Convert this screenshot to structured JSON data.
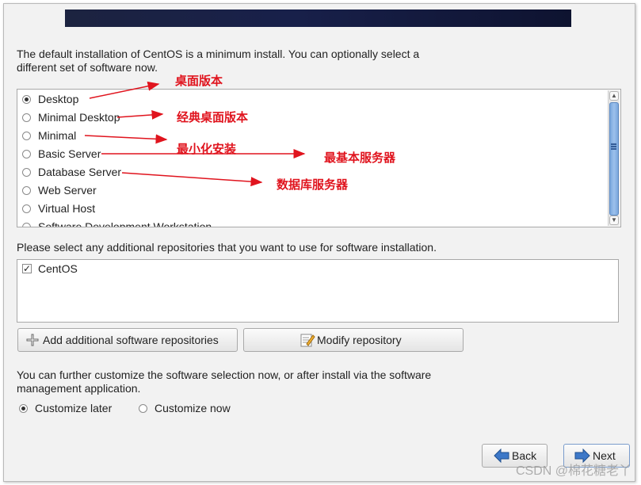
{
  "intro_text_line1": "The default installation of CentOS is a minimum install. You can optionally select a",
  "intro_text_line2": "different set of software now.",
  "software_sets": [
    {
      "label": "Desktop",
      "selected": true
    },
    {
      "label": "Minimal Desktop",
      "selected": false
    },
    {
      "label": "Minimal",
      "selected": false
    },
    {
      "label": "Basic Server",
      "selected": false
    },
    {
      "label": "Database Server",
      "selected": false
    },
    {
      "label": "Web Server",
      "selected": false
    },
    {
      "label": "Virtual Host",
      "selected": false
    },
    {
      "label": "Software Development Workstation",
      "selected": false
    }
  ],
  "repos_label": "Please select any additional repositories that you want to use for software installation.",
  "repositories": [
    {
      "label": "CentOS",
      "checked": true
    }
  ],
  "buttons": {
    "add_repo": "Add additional software repositories",
    "modify_repo": "Modify repository",
    "back": "Back",
    "next": "Next"
  },
  "customize_text_line1": "You can further customize the software selection now, or after install via the software",
  "customize_text_line2": "management application.",
  "customize_options": [
    {
      "label": "Customize later",
      "selected": true
    },
    {
      "label": "Customize now",
      "selected": false
    }
  ],
  "annotations": {
    "desktop": "桌面版本",
    "minimal_desktop": "经典桌面版本",
    "minimal": "最小化安装",
    "basic_server": "最基本服务器",
    "database_server": "数据库服务器"
  },
  "watermark": "CSDN @棉花糖老丫",
  "colors": {
    "annotation": "#e0141e",
    "banner": "#18204a",
    "scroll_thumb": "#8fb8e8"
  }
}
